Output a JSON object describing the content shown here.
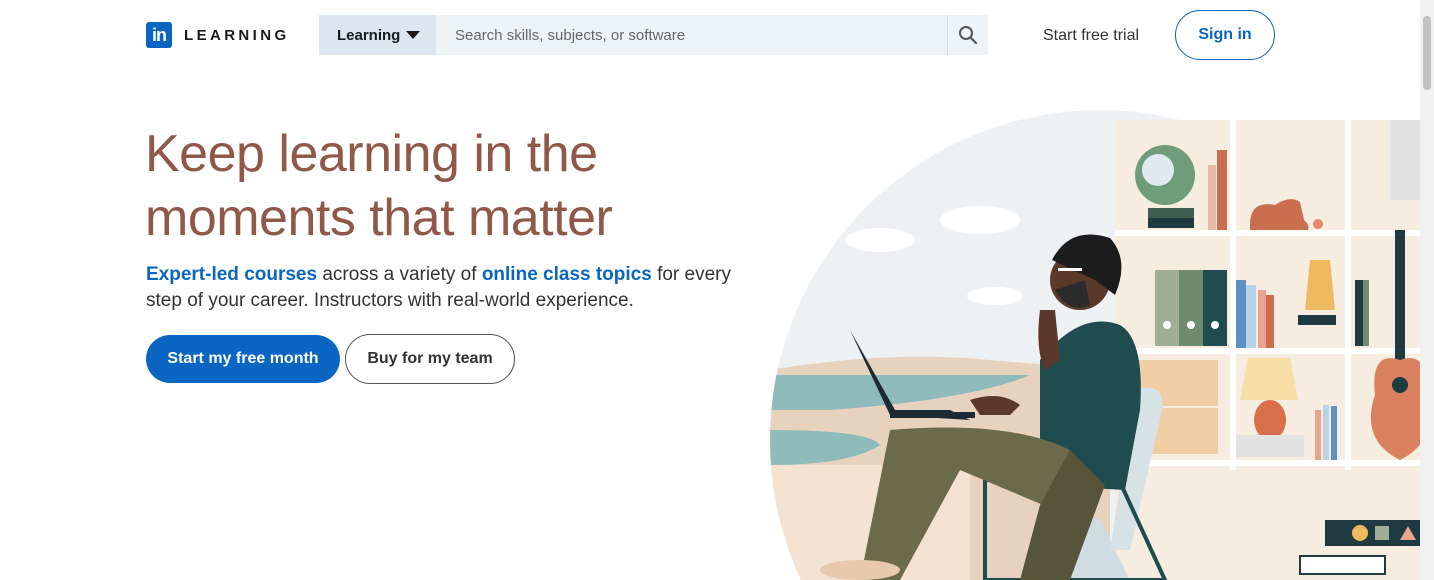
{
  "brand": {
    "logo_mark": "in",
    "product": "LEARNING",
    "accent": "#0a66c2"
  },
  "search": {
    "category": "Learning",
    "placeholder": "Search skills, subjects, or software",
    "icon": "search-icon"
  },
  "nav": {
    "trial_label": "Start free trial",
    "signin_label": "Sign in"
  },
  "hero": {
    "title": "Keep learning in the moments that matter",
    "link1": "Expert-led courses",
    "text1": " across a variety of ",
    "link2": "online class topics",
    "text2": " for every step of your career. Instructors with real-world experience.",
    "title_color": "#8f5849"
  },
  "cta": {
    "primary": "Start my free month",
    "secondary": "Buy for my team"
  }
}
